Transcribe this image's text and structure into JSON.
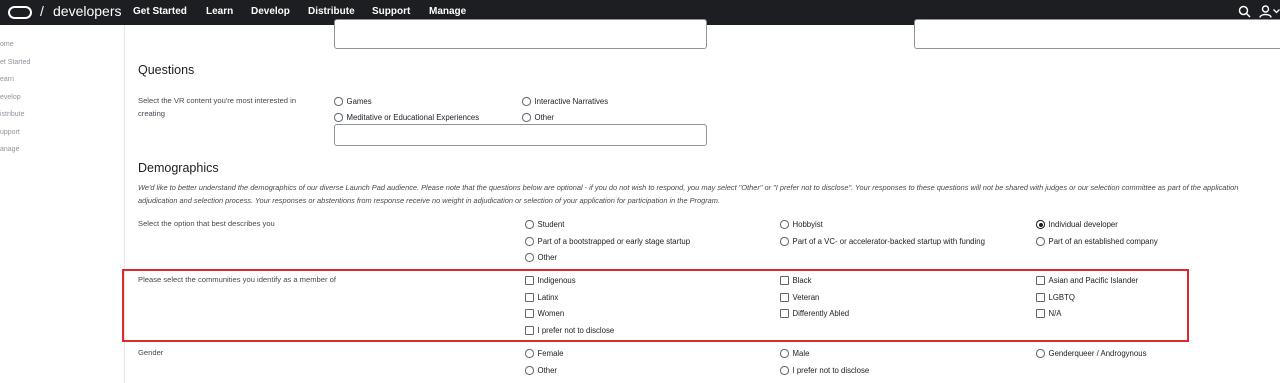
{
  "header": {
    "slash": "/",
    "brand": "developers",
    "nav": [
      "Get Started",
      "Learn",
      "Develop",
      "Distribute",
      "Support",
      "Manage"
    ],
    "icons": [
      "search-icon",
      "user-icon",
      "chevron-down-icon"
    ]
  },
  "sidebar": {
    "items": [
      "ome",
      "et Started",
      "earn",
      "evelop",
      "istribute",
      "upport",
      "anage"
    ]
  },
  "questions": {
    "title": "Questions",
    "vr_label": "Select the VR content you're most interested in creating",
    "vr_options": [
      "Games",
      "Interactive Narratives",
      "Meditative or Educational Experiences",
      "Other"
    ]
  },
  "demographics": {
    "title": "Demographics",
    "description": "We'd like to better understand the demographics of our diverse Launch Pad audience. Please note that the questions below are optional - if you do not wish to respond, you may select \"Other\" or \"I prefer not to disclose\". Your responses to these questions will not be shared with judges or our selection committee as part of the application adjudication and selection process. Your responses or abstentions from response receive no weight in adjudication or selection of your application for participation in the Program.",
    "describe_label": "Select the option that best describes you",
    "describe_options": [
      "Student",
      "Hobbyist",
      "Individual developer",
      "Part of a bootstrapped or early stage startup",
      "Part of a VC- or accelerator-backed startup with funding",
      "Part of an established company",
      "Other"
    ],
    "describe_selected": "Individual developer",
    "communities_label": "Please select the communities you identify as a member of",
    "communities_options": [
      "Indigenous",
      "Black",
      "Asian and Pacific Islander",
      "Latinx",
      "Veteran",
      "LGBTQ",
      "Women",
      "Differently Abled",
      "N/A",
      "I prefer not to disclose"
    ],
    "gender_label": "Gender",
    "gender_options": [
      "Female",
      "Male",
      "Genderqueer / Androgynous",
      "Other",
      "I prefer not to disclose"
    ]
  },
  "colors": {
    "topbar": "#1c1e21",
    "highlight": "#e0272b"
  }
}
